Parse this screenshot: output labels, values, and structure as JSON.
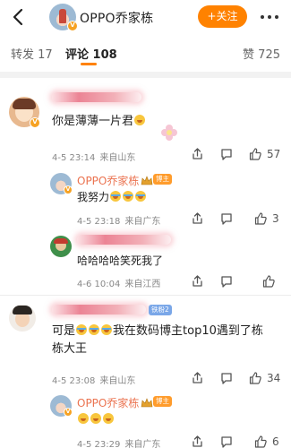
{
  "header": {
    "title": "OPPO乔家栋",
    "follow_label": "+关注"
  },
  "tabs": {
    "repost": "转发 17",
    "comments": "评论 108",
    "likes": "赞 725"
  },
  "comments": [
    {
      "text": "你是薄薄一片君",
      "time": "4-5 23:14",
      "location": "来自山东",
      "likes": "57"
    },
    {
      "author": "OPPO乔家栋",
      "badge": "博主",
      "text": "我努力",
      "time": "4-5 23:18",
      "location": "来自广东",
      "likes": "3"
    },
    {
      "text": "哈哈哈哈笑死我了",
      "time": "4-6 10:04",
      "location": "来自江西"
    },
    {
      "tag": "铁粉2",
      "text_line1": "我在数码博主top10遇到了栋",
      "text_line1_prefix": "可是",
      "text_line2": "栋大王",
      "time": "4-5 23:08",
      "location": "来自山东",
      "likes": "34"
    },
    {
      "author": "OPPO乔家栋",
      "badge": "博主",
      "time": "4-5 23:29",
      "location": "来自广东",
      "likes": "6"
    }
  ]
}
